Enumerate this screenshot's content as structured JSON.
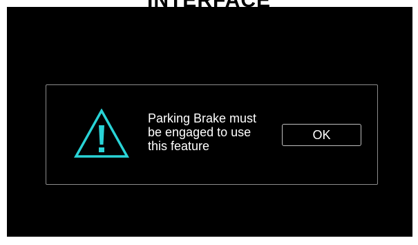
{
  "header": {
    "title": "INTERFACE"
  },
  "dialog": {
    "icon": "warning-triangle-icon",
    "message_lines": [
      "Parking Brake must",
      "be engaged to use",
      "this feature"
    ],
    "ok_label": "OK"
  },
  "colors": {
    "screen_background": "#000000",
    "accent_icon": "#29d3d6",
    "text": "#ffffff",
    "dialog_border": "#8c8c8c"
  }
}
